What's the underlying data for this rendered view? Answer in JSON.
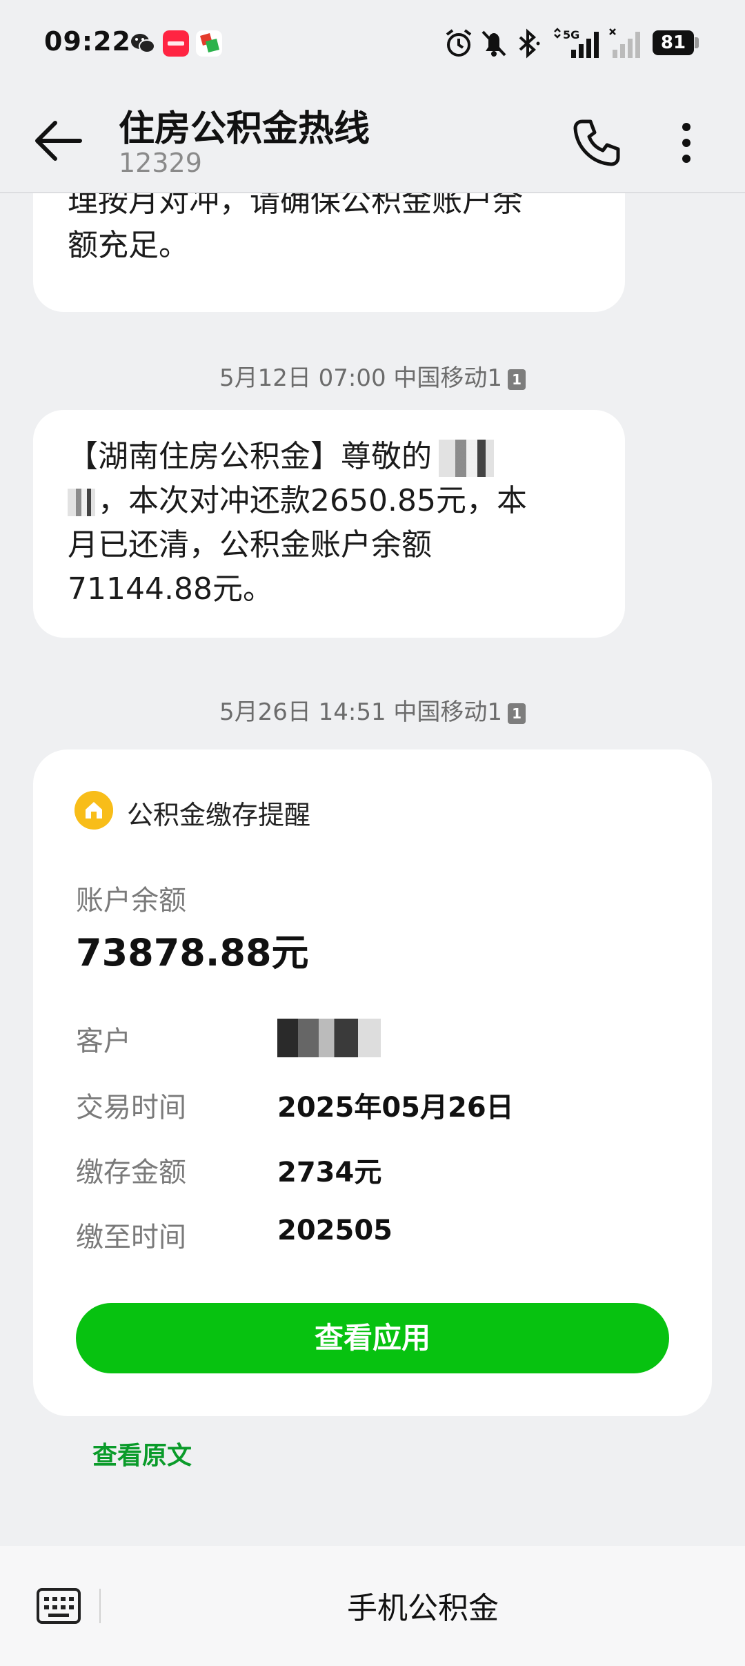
{
  "status_bar": {
    "time": "09:22",
    "battery": "81",
    "network": "5G",
    "icons": [
      "wechat-icon",
      "xiaohongshu-icon",
      "app-icon",
      "alarm-icon",
      "mute-icon",
      "bluetooth-icon",
      "signal-icon",
      "signal-icon-sim2",
      "battery-icon"
    ]
  },
  "header": {
    "title": "住房公积金热线",
    "number": "12329"
  },
  "messages": {
    "first": {
      "text": "理按月对冲，请确保公积金账户余\n额充足。"
    },
    "second": {
      "timestamp": "5月12日 07:00 中国移动1",
      "sim": "1",
      "line1": "【湖南住房公积金】尊敬的",
      "line2": "，本次对冲还款2650.85元，本",
      "line3": "月已还清，公积金账户余额",
      "line4": "71144.88元。"
    },
    "third": {
      "timestamp": "5月26日 14:51 中国移动1",
      "sim": "1"
    }
  },
  "card": {
    "title": "公积金缴存提醒",
    "balance_label": "账户余额",
    "balance_value": "73878.88元",
    "rows": [
      {
        "label": "客户",
        "value": ""
      },
      {
        "label": "交易时间",
        "value": "2025年05月26日"
      },
      {
        "label": "缴存金额",
        "value": "2734元"
      },
      {
        "label": "缴至时间",
        "value": "202505"
      }
    ],
    "button_label": "查看应用"
  },
  "view_original": "查看原文",
  "bottom_bar": {
    "menu_label": "手机公积金"
  },
  "colors": {
    "accent_green": "#07c210",
    "link_green": "#0a9b2a",
    "card_icon": "#f8bd19",
    "background": "#eff0f2"
  }
}
